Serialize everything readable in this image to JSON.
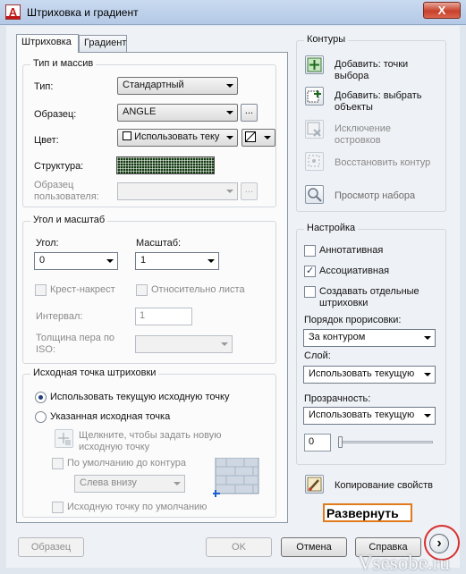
{
  "window": {
    "title": "Штриховка и градиент",
    "close_label": "X"
  },
  "tabs": [
    {
      "label": "Штриховка",
      "active": true
    },
    {
      "label": "Градиент",
      "active": false
    }
  ],
  "type_pattern": {
    "group_title": "Тип и массив",
    "type_label": "Тип:",
    "type_value": "Стандартный",
    "pattern_label": "Образец:",
    "pattern_value": "ANGLE",
    "color_label": "Цвет:",
    "color_value": "Использовать теку",
    "swatch_label": "Структура:",
    "custom_label_1": "Образец",
    "custom_label_2": "пользователя:"
  },
  "angle_scale": {
    "group_title": "Угол и масштаб",
    "angle_label": "Угол:",
    "angle_value": "0",
    "scale_label": "Масштаб:",
    "scale_value": "1",
    "double_label": "Крест-накрест",
    "relative_label": "Относительно листа",
    "spacing_label": "Интервал:",
    "spacing_value": "1",
    "pen_label_1": "Толщина пера по",
    "pen_label_2": "ISO:"
  },
  "origin": {
    "group_title": "Исходная точка штриховки",
    "use_current_label": "Использовать текущую исходную точку",
    "specified_label": "Указанная исходная точка",
    "click_label_1": "Щелкните, чтобы задать новую",
    "click_label_2": "исходную точку",
    "default_extents_label": "По умолчанию до контура",
    "position_value": "Слева внизу",
    "store_default_label": "Исходную точку по умолчанию"
  },
  "boundaries": {
    "group_title": "Контуры",
    "add_pick_1": "Добавить: точки",
    "add_pick_2": "выбора",
    "add_select_1": "Добавить: выбрать",
    "add_select_2": "объекты",
    "remove_1": "Исключение",
    "remove_2": "островков",
    "recreate": "Восстановить контур",
    "view_selections": "Просмотр набора"
  },
  "options": {
    "group_title": "Настройка",
    "annotative_label": "Аннотативная",
    "annotative": false,
    "associative_label": "Ассоциативная",
    "associative": true,
    "separate_1": "Создавать отдельные",
    "separate_2": "штриховки",
    "separate": false,
    "draw_order_label": "Порядок прорисовки:",
    "draw_order_value": "За контуром",
    "layer_label": "Слой:",
    "layer_value": "Использовать текущую",
    "transparency_label": "Прозрачность:",
    "transparency_value": "Использовать текущую",
    "transparency_number": "0",
    "transparency_level": 0
  },
  "inherit_label": "Копирование свойств",
  "footer": {
    "preview": "Образец",
    "ok": "OK",
    "cancel": "Отмена",
    "help": "Справка",
    "expand_symbol": "›"
  },
  "annotation": {
    "expand_text": "Развернуть"
  },
  "watermark": "Vsesobe.ru",
  "colors": {
    "accent_orange": "#e07a1a",
    "annotation_red": "#d83030",
    "swatch_green": "#123a10"
  }
}
